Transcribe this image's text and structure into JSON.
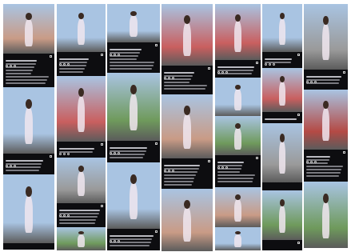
{
  "collage": {
    "columns": 7,
    "photo_tints": {
      "sky": "#a9c4e2",
      "seaside_red_railing": "#c95f5f",
      "park_green": "#6f9a5c",
      "street_gray": "#9a9a9a",
      "shrine_red": "#b44a45",
      "indoor_warm": "#c99b86"
    },
    "post_panel_color": "#0d0d10"
  }
}
